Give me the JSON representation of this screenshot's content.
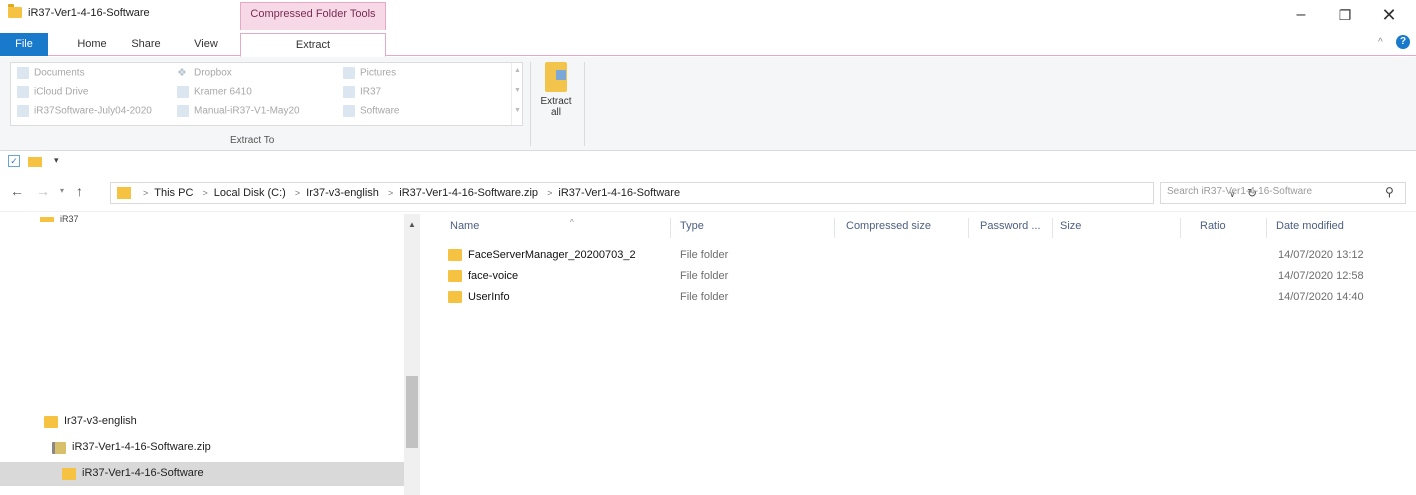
{
  "window": {
    "title": "iR37-Ver1-4-16-Software",
    "context_tab": "Compressed Folder Tools",
    "min_glyph": "–",
    "max_glyph": "❐",
    "close_glyph": "✕"
  },
  "ribbon_tabs": {
    "file": "File",
    "home": "Home",
    "share": "Share",
    "view": "View",
    "extract": "Extract",
    "collapse_glyph": "^",
    "help_glyph": "?"
  },
  "ribbon": {
    "destinations": [
      {
        "label": "Documents",
        "icon": "documents-icon"
      },
      {
        "label": "iCloud Drive",
        "icon": "cloud-icon"
      },
      {
        "label": "iR37Software-July04-2020",
        "icon": "folder-icon"
      },
      {
        "label": "Dropbox",
        "icon": "dropbox-icon"
      },
      {
        "label": "Kramer 6410",
        "icon": "folder-icon"
      },
      {
        "label": "Manual-iR37-V1-May20",
        "icon": "folder-icon"
      },
      {
        "label": "Pictures",
        "icon": "pictures-icon"
      },
      {
        "label": "IR37",
        "icon": "folder-icon"
      },
      {
        "label": "Software",
        "icon": "folder-icon"
      }
    ],
    "dropbox_glyph": "❖",
    "group_label": "Extract To",
    "extract_all_line1": "Extract",
    "extract_all_line2": "all"
  },
  "qat": {
    "check_glyph": "✓",
    "dropdown_glyph": "▾"
  },
  "address": {
    "back_glyph": "←",
    "forward_glyph": "→",
    "recent_glyph": "▾",
    "up_glyph": "↑",
    "crumbs": [
      "This PC",
      "Local Disk (C:)",
      "Ir37-v3-english",
      "iR37-Ver1-4-16-Software.zip",
      "iR37-Ver1-4-16-Software"
    ],
    "separator_glyph": ">",
    "dropdown_glyph": "∨",
    "refresh_glyph": "↻",
    "search_placeholder": "Search iR37-Ver1-4-16-Software",
    "search_glyph": "⚲"
  },
  "nav_pane": {
    "top_fragment": "iR37",
    "items": [
      {
        "label": "Ir37-v3-english",
        "type": "folder"
      },
      {
        "label": "iR37-Ver1-4-16-Software.zip",
        "type": "zip"
      },
      {
        "label": "iR37-Ver1-4-16-Software",
        "type": "folder"
      }
    ],
    "scroll_up_glyph": "▲"
  },
  "columns": {
    "name": "Name",
    "type": "Type",
    "compressed_size": "Compressed size",
    "password": "Password ...",
    "size": "Size",
    "ratio": "Ratio",
    "date_modified": "Date modified",
    "sort_glyph": "^"
  },
  "files": [
    {
      "name": "FaceServerManager_20200703_2",
      "type": "File folder",
      "date": "14/07/2020 13:12"
    },
    {
      "name": "face-voice",
      "type": "File folder",
      "date": "14/07/2020 12:58"
    },
    {
      "name": "UserInfo",
      "type": "File folder",
      "date": "14/07/2020 14:40"
    }
  ],
  "colors": {
    "accent": "#1979ca",
    "context_tab_bg": "#f7d8e6",
    "folder": "#f5c242"
  }
}
